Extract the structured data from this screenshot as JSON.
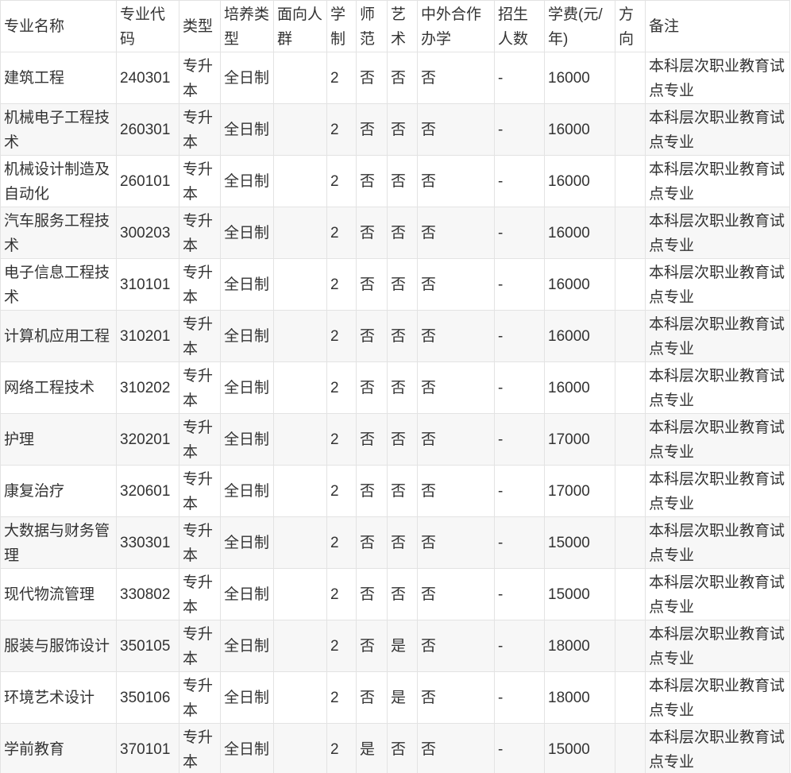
{
  "table": {
    "headers": [
      "专业名称",
      "专业代码",
      "类型",
      "培养类型",
      "面向人群",
      "学制",
      "师范",
      "艺术",
      "中外合作办学",
      "招生人数",
      "学费(元/年)",
      "方向",
      "备注"
    ],
    "rows": [
      [
        "建筑工程",
        "240301",
        "专升本",
        "全日制",
        "",
        "2",
        "否",
        "否",
        "否",
        "-",
        "16000",
        "",
        "本科层次职业教育试点专业"
      ],
      [
        "机械电子工程技术",
        "260301",
        "专升本",
        "全日制",
        "",
        "2",
        "否",
        "否",
        "否",
        "-",
        "16000",
        "",
        "本科层次职业教育试点专业"
      ],
      [
        "机械设计制造及自动化",
        "260101",
        "专升本",
        "全日制",
        "",
        "2",
        "否",
        "否",
        "否",
        "-",
        "16000",
        "",
        "本科层次职业教育试点专业"
      ],
      [
        "汽车服务工程技术",
        "300203",
        "专升本",
        "全日制",
        "",
        "2",
        "否",
        "否",
        "否",
        "-",
        "16000",
        "",
        "本科层次职业教育试点专业"
      ],
      [
        "电子信息工程技术",
        "310101",
        "专升本",
        "全日制",
        "",
        "2",
        "否",
        "否",
        "否",
        "-",
        "16000",
        "",
        "本科层次职业教育试点专业"
      ],
      [
        "计算机应用工程",
        "310201",
        "专升本",
        "全日制",
        "",
        "2",
        "否",
        "否",
        "否",
        "-",
        "16000",
        "",
        "本科层次职业教育试点专业"
      ],
      [
        "网络工程技术",
        "310202",
        "专升本",
        "全日制",
        "",
        "2",
        "否",
        "否",
        "否",
        "-",
        "16000",
        "",
        "本科层次职业教育试点专业"
      ],
      [
        "护理",
        "320201",
        "专升本",
        "全日制",
        "",
        "2",
        "否",
        "否",
        "否",
        "-",
        "17000",
        "",
        "本科层次职业教育试点专业"
      ],
      [
        "康复治疗",
        "320601",
        "专升本",
        "全日制",
        "",
        "2",
        "否",
        "否",
        "否",
        "-",
        "17000",
        "",
        "本科层次职业教育试点专业"
      ],
      [
        "大数据与财务管理",
        "330301",
        "专升本",
        "全日制",
        "",
        "2",
        "否",
        "否",
        "否",
        "-",
        "15000",
        "",
        "本科层次职业教育试点专业"
      ],
      [
        "现代物流管理",
        "330802",
        "专升本",
        "全日制",
        "",
        "2",
        "否",
        "否",
        "否",
        "-",
        "15000",
        "",
        "本科层次职业教育试点专业"
      ],
      [
        "服装与服饰设计",
        "350105",
        "专升本",
        "全日制",
        "",
        "2",
        "否",
        "是",
        "否",
        "-",
        "18000",
        "",
        "本科层次职业教育试点专业"
      ],
      [
        "环境艺术设计",
        "350106",
        "专升本",
        "全日制",
        "",
        "2",
        "否",
        "是",
        "否",
        "-",
        "18000",
        "",
        "本科层次职业教育试点专业"
      ],
      [
        "学前教育",
        "370101",
        "专升本",
        "全日制",
        "",
        "2",
        "是",
        "否",
        "否",
        "-",
        "15000",
        "",
        "本科层次职业教育试点专业"
      ]
    ]
  },
  "colors": {
    "header_bg": "#f7f7f7",
    "alt_row_bg": "#f7f7f7",
    "border": "#e3e3e3",
    "text": "#333333"
  }
}
